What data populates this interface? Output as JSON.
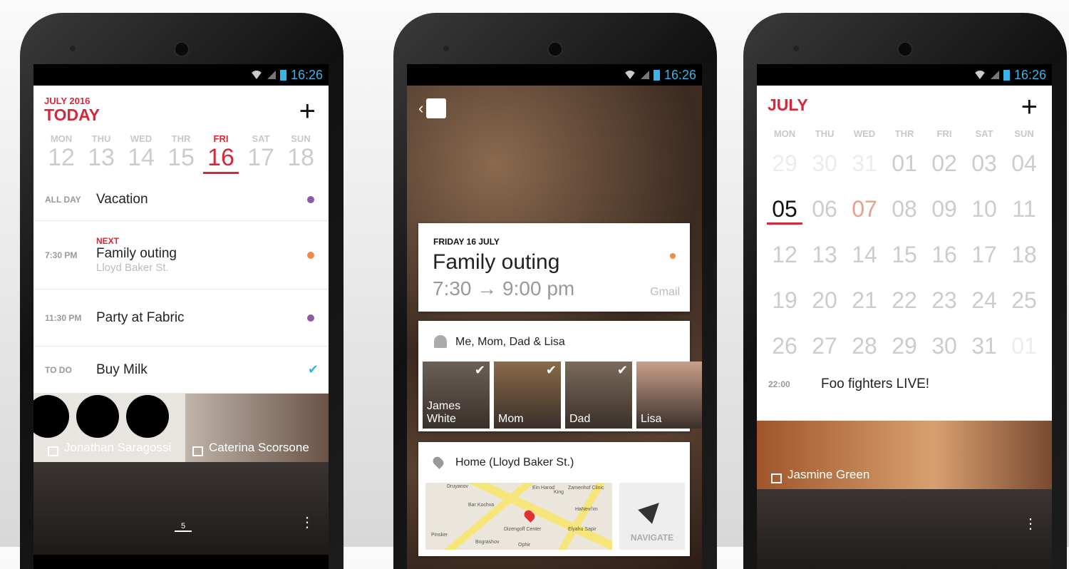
{
  "status": {
    "time": "16:26"
  },
  "phone1": {
    "month_label": "JULY 2016",
    "title": "TODAY",
    "week": [
      {
        "day": "MON",
        "date": "12"
      },
      {
        "day": "THU",
        "date": "13"
      },
      {
        "day": "WED",
        "date": "14"
      },
      {
        "day": "THR",
        "date": "15"
      },
      {
        "day": "FRI",
        "date": "16",
        "selected": true
      },
      {
        "day": "SAT",
        "date": "17"
      },
      {
        "day": "SUN",
        "date": "18"
      }
    ],
    "events": [
      {
        "time": "ALL DAY",
        "title": "Vacation",
        "dot": "#8e5aa6"
      },
      {
        "badge": "NEXT",
        "time": "7:30 PM",
        "title": "Family outing",
        "location": "Lloyd Baker St.",
        "dot": "#f08a4b"
      },
      {
        "time": "11:30 PM",
        "title": "Party at Fabric",
        "dot": "#8e5aa6"
      },
      {
        "time": "TO DO",
        "title": "Buy Milk",
        "check": "✔"
      }
    ],
    "birthdays": [
      "Jonathan Saragossi",
      "Caterina Scorsone"
    ],
    "bottom_badge": "5"
  },
  "phone2": {
    "date": "FRIDAY 16 JULY",
    "title": "Family outing",
    "time": "7:30 → 9:00 pm",
    "source": "Gmail",
    "dot": "#f08a4b",
    "attendees_label": "Me, Mom, Dad & Lisa",
    "attendees": [
      {
        "name": "James White",
        "checked": true
      },
      {
        "name": "Mom",
        "checked": true
      },
      {
        "name": "Dad",
        "checked": true
      },
      {
        "name": "Lisa",
        "checked": false
      }
    ],
    "location": "Home (Lloyd Baker St.)",
    "map_labels": [
      "Druyanov",
      "Pinsker",
      "Bar Kochva",
      "Dizengoff Center",
      "Bograshov",
      "Ophir",
      "Zamenhof Clinic",
      "HaNevi'im",
      "Elyahu Sapir",
      "King",
      "Ein Harod"
    ],
    "navigate": "NAVIGATE"
  },
  "phone3": {
    "month": "JULY",
    "weekdays": [
      "MON",
      "THU",
      "WED",
      "THR",
      "FRI",
      "SAT",
      "SUN"
    ],
    "weeks": [
      [
        "29",
        "30",
        "31",
        "01",
        "02",
        "03",
        "04"
      ],
      [
        "05",
        "06",
        "07",
        "08",
        "09",
        "10",
        "11"
      ],
      [
        "12",
        "13",
        "14",
        "15",
        "16",
        "17",
        "18"
      ],
      [
        "19",
        "20",
        "21",
        "22",
        "23",
        "24",
        "25"
      ],
      [
        "26",
        "27",
        "28",
        "29",
        "30",
        "31",
        "01"
      ]
    ],
    "selected": "05",
    "highlight": "07",
    "event": {
      "time": "22:00",
      "title": "Foo fighters LIVE!"
    },
    "birthday": "Jasmine Green"
  },
  "colors": {
    "accent": "#d62839",
    "status": "#3ab4e8"
  }
}
